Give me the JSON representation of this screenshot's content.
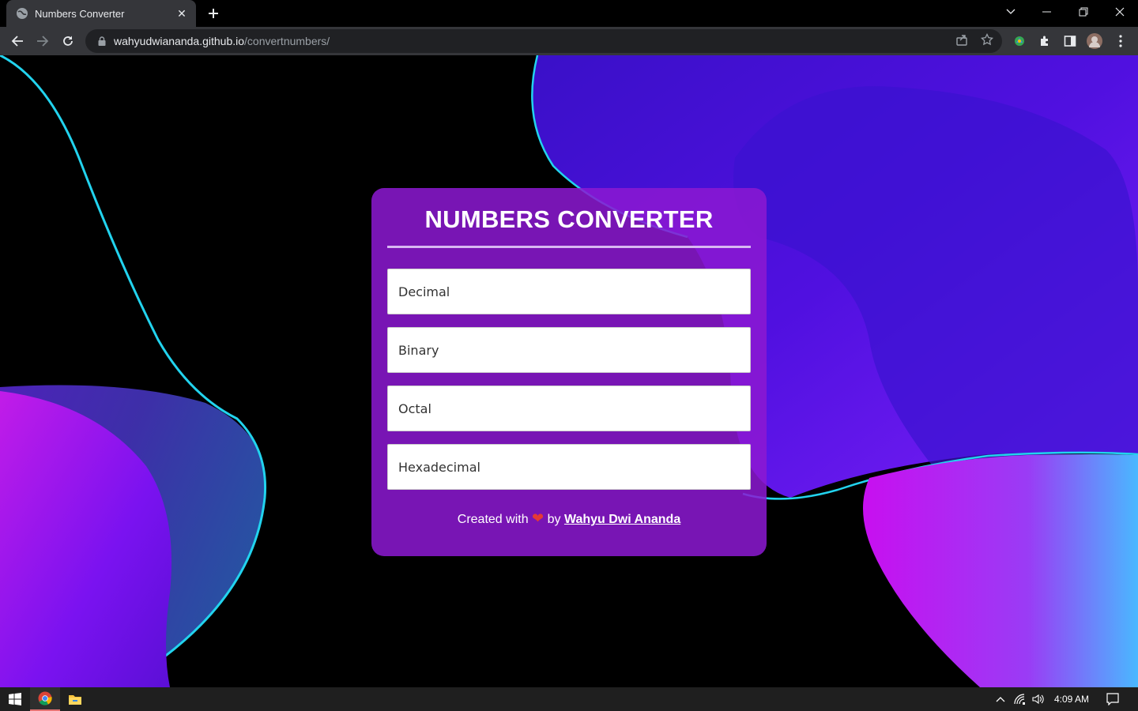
{
  "browser": {
    "tab_title": "Numbers Converter",
    "url_host": "wahyudwiananda.github.io",
    "url_path": "/convertnumbers/"
  },
  "page": {
    "title": "NUMBERS CONVERTER",
    "fields": {
      "decimal_placeholder": "Decimal",
      "binary_placeholder": "Binary",
      "octal_placeholder": "Octal",
      "hexadecimal_placeholder": "Hexadecimal"
    },
    "credit_prefix": "Created with",
    "credit_heart": "❤",
    "credit_by": "by",
    "credit_author": "Wahyu Dwi Ananda"
  },
  "taskbar": {
    "time": "4:09 AM"
  },
  "colors": {
    "card_bg": "#8c19d2",
    "accent_cyan": "#22d3ee",
    "heart": "#e53935"
  },
  "icons": [
    "globe-icon",
    "close-icon",
    "plus-icon",
    "chevron-down-icon",
    "minimize-icon",
    "restore-icon",
    "window-close-icon",
    "back-icon",
    "forward-icon",
    "reload-icon",
    "lock-icon",
    "share-icon",
    "star-icon",
    "extension-icon",
    "puzzle-icon",
    "sidepanel-icon",
    "avatar",
    "menu-icon",
    "windows-start-icon",
    "chrome-icon",
    "file-explorer-icon",
    "chevron-up-icon",
    "network-icon",
    "volume-icon",
    "notification-icon"
  ]
}
